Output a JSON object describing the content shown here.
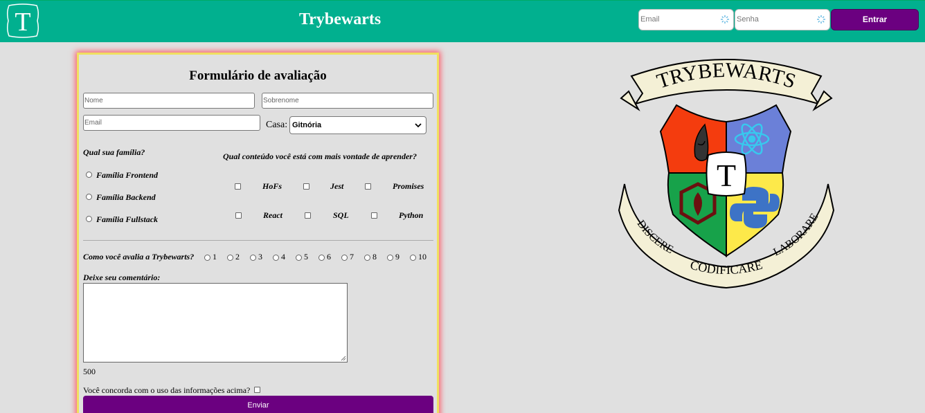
{
  "header": {
    "brand": "Trybewarts",
    "logo_letter": "T",
    "email_placeholder": "Email",
    "password_placeholder": "Senha",
    "login_label": "Entrar",
    "colors": {
      "bar": "#01b08f",
      "button": "#6b0080"
    }
  },
  "form": {
    "title": "Formulário de avaliação",
    "name_placeholder": "Nome",
    "lastname_placeholder": "Sobrenome",
    "email_placeholder": "Email",
    "house_label": "Casa:",
    "house_selected": "Gitnória",
    "family_question": "Qual sua família?",
    "families": [
      "Família Frontend",
      "Família Backend",
      "Família Fullstack"
    ],
    "content_question": "Qual conteúdo você está com mais vontade de aprender?",
    "contents": [
      "HoFs",
      "Jest",
      "Promises",
      "React",
      "SQL",
      "Python"
    ],
    "rating_question": "Como você avalia a Trybewarts?",
    "ratings": [
      "1",
      "2",
      "3",
      "4",
      "5",
      "6",
      "7",
      "8",
      "9",
      "10"
    ],
    "comment_label": "Deixe seu comentário:",
    "counter": "500",
    "agree_label": "Você concorda com o uso das informações acima?",
    "submit_label": "Enviar"
  },
  "crest": {
    "banner_top": "TRYBEWARTS",
    "center_letter": "T",
    "motto_left": "DISCERE",
    "motto_center": "CODIFICARE",
    "motto_right": "LABORARE"
  }
}
